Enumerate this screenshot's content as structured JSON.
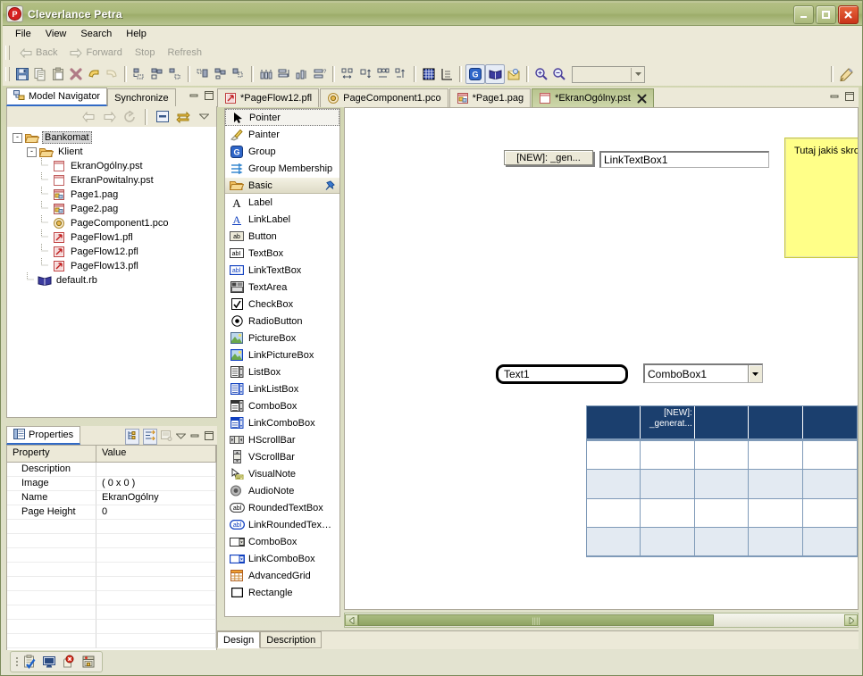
{
  "window": {
    "title": "Cleverlance Petra",
    "app_icon": "petra-logo-icon",
    "minimize": "_",
    "maximize": "□",
    "close": "✕"
  },
  "menubar": {
    "items": [
      "File",
      "View",
      "Search",
      "Help"
    ]
  },
  "nav_toolbar": {
    "back": "Back",
    "forward": "Forward",
    "stop": "Stop",
    "refresh": "Refresh"
  },
  "main_toolbar": {
    "zoom_value": "",
    "icons": [
      "save-icon",
      "copy-icon",
      "paste-icon",
      "delete-icon",
      "undo-icon",
      "redo-icon",
      "align-left-icon",
      "align-center-icon",
      "align-right-icon",
      "align-top-icon",
      "align-middle-icon",
      "align-bottom-icon",
      "distribute-h-icon",
      "distribute-v-icon",
      "space-h-icon",
      "space-v-icon",
      "size-width-icon",
      "size-height-icon",
      "size-both-icon",
      "size-grid-icon",
      "grid-icon",
      "ruler-icon",
      "group-icon",
      "book-icon",
      "mail-icon",
      "zoom-in-icon",
      "zoom-out-icon",
      "pencil-icon"
    ]
  },
  "navigator": {
    "tabs": [
      {
        "label": "Model Navigator",
        "icon": "model-navigator-icon",
        "active": true
      },
      {
        "label": "Synchronize",
        "icon": "",
        "active": false
      }
    ],
    "toolbar_icons": [
      "back-arrow-icon",
      "forward-arrow-icon",
      "refresh-icon",
      "collapse-all-icon",
      "link-editor-icon",
      "view-menu-icon"
    ],
    "panel_controls": [
      "minimize-icon",
      "maximize-icon"
    ],
    "tree": [
      {
        "label": "Bankomat",
        "icon": "folder-open-icon",
        "depth": 0,
        "expander": "-",
        "selected": true
      },
      {
        "label": "Klient",
        "icon": "folder-open-icon",
        "depth": 1,
        "expander": "-",
        "selected": false
      },
      {
        "label": "EkranOgólny.pst",
        "icon": "screen-file-icon",
        "depth": 2,
        "expander": "",
        "selected": false
      },
      {
        "label": "EkranPowitalny.pst",
        "icon": "screen-file-icon",
        "depth": 2,
        "expander": "",
        "selected": false
      },
      {
        "label": "Page1.pag",
        "icon": "page-file-icon",
        "depth": 2,
        "expander": "",
        "selected": false
      },
      {
        "label": "Page2.pag",
        "icon": "page-file-icon",
        "depth": 2,
        "expander": "",
        "selected": false
      },
      {
        "label": "PageComponent1.pco",
        "icon": "component-file-icon",
        "depth": 2,
        "expander": "",
        "selected": false
      },
      {
        "label": "PageFlow1.pfl",
        "icon": "flow-file-icon",
        "depth": 2,
        "expander": "",
        "selected": false
      },
      {
        "label": "PageFlow12.pfl",
        "icon": "flow-file-icon",
        "depth": 2,
        "expander": "",
        "selected": false
      },
      {
        "label": "PageFlow13.pfl",
        "icon": "flow-file-icon",
        "depth": 2,
        "expander": "",
        "selected": false
      },
      {
        "label": "default.rb",
        "icon": "book-file-icon",
        "depth": 1,
        "expander": "",
        "selected": false
      }
    ]
  },
  "properties": {
    "tab_label": "Properties",
    "tab_icon": "properties-icon",
    "toolbar_icons": [
      "categorize-icon",
      "sort-icon",
      "restore-default-icon",
      "view-menu-icon",
      "minimize-icon",
      "maximize-icon"
    ],
    "columns": [
      "Property",
      "Value"
    ],
    "rows": [
      {
        "property": "Description",
        "value": ""
      },
      {
        "property": "Image",
        "value": "( 0 x 0 )"
      },
      {
        "property": "Name",
        "value": "EkranOgólny"
      },
      {
        "property": "Page Height",
        "value": "0"
      }
    ]
  },
  "palette": {
    "items": [
      {
        "label": "Pointer",
        "icon": "pointer-icon",
        "kind": "tool",
        "selected": true
      },
      {
        "label": "Painter",
        "icon": "painter-icon",
        "kind": "tool",
        "selected": false
      },
      {
        "label": "Group",
        "icon": "group-g-icon",
        "kind": "tool",
        "selected": false
      },
      {
        "label": "Group Membership",
        "icon": "group-membership-icon",
        "kind": "tool",
        "selected": false
      },
      {
        "label": "Basic",
        "icon": "folder-open-icon",
        "kind": "category",
        "selected": false,
        "pin": "pin-icon"
      },
      {
        "label": "Label",
        "icon": "label-icon",
        "kind": "widget",
        "selected": false
      },
      {
        "label": "LinkLabel",
        "icon": "link-label-icon",
        "kind": "widget",
        "selected": false
      },
      {
        "label": "Button",
        "icon": "button-icon",
        "kind": "widget",
        "selected": false
      },
      {
        "label": "TextBox",
        "icon": "textbox-icon",
        "kind": "widget",
        "selected": false
      },
      {
        "label": "LinkTextBox",
        "icon": "link-textbox-icon",
        "kind": "widget",
        "selected": false
      },
      {
        "label": "TextArea",
        "icon": "textarea-icon",
        "kind": "widget",
        "selected": false
      },
      {
        "label": "CheckBox",
        "icon": "checkbox-icon",
        "kind": "widget",
        "selected": false
      },
      {
        "label": "RadioButton",
        "icon": "radiobutton-icon",
        "kind": "widget",
        "selected": false
      },
      {
        "label": "PictureBox",
        "icon": "picturebox-icon",
        "kind": "widget",
        "selected": false
      },
      {
        "label": "LinkPictureBox",
        "icon": "link-picturebox-icon",
        "kind": "widget",
        "selected": false
      },
      {
        "label": "ListBox",
        "icon": "listbox-icon",
        "kind": "widget",
        "selected": false
      },
      {
        "label": "LinkListBox",
        "icon": "link-listbox-icon",
        "kind": "widget",
        "selected": false
      },
      {
        "label": "ComboBox",
        "icon": "combobox-list-icon",
        "kind": "widget",
        "selected": false
      },
      {
        "label": "LinkComboBox",
        "icon": "link-combobox-list-icon",
        "kind": "widget",
        "selected": false
      },
      {
        "label": "HScrollBar",
        "icon": "hscrollbar-icon",
        "kind": "widget",
        "selected": false
      },
      {
        "label": "VScrollBar",
        "icon": "vscrollbar-icon",
        "kind": "widget",
        "selected": false
      },
      {
        "label": "VisualNote",
        "icon": "visualnote-icon",
        "kind": "widget",
        "selected": false
      },
      {
        "label": "AudioNote",
        "icon": "audionote-icon",
        "kind": "widget",
        "selected": false
      },
      {
        "label": "RoundedTextBox",
        "icon": "rounded-textbox-icon",
        "kind": "widget",
        "selected": false
      },
      {
        "label": "LinkRoundedTex…",
        "icon": "link-rounded-textbox-icon",
        "kind": "widget",
        "selected": false
      },
      {
        "label": "ComboBox",
        "icon": "combobox-icon",
        "kind": "widget",
        "selected": false
      },
      {
        "label": "LinkComboBox",
        "icon": "link-combobox-icon",
        "kind": "widget",
        "selected": false
      },
      {
        "label": "AdvancedGrid",
        "icon": "advancedgrid-icon",
        "kind": "widget",
        "selected": false
      },
      {
        "label": "Rectangle",
        "icon": "rectangle-icon",
        "kind": "widget",
        "selected": false
      }
    ]
  },
  "editor": {
    "tabs": [
      {
        "label": "*PageFlow12.pfl",
        "icon": "flow-file-icon",
        "active": false,
        "closable": false
      },
      {
        "label": "PageComponent1.pco",
        "icon": "component-file-icon",
        "active": false,
        "closable": false
      },
      {
        "label": "*Page1.pag",
        "icon": "page-file-icon",
        "active": false,
        "closable": false
      },
      {
        "label": "*EkranOgólny.pst",
        "icon": "screen-file-icon",
        "active": true,
        "closable": true,
        "close_icon": "close-icon"
      }
    ],
    "panel_controls": [
      "minimize-icon",
      "maximize-icon"
    ],
    "bottom_tabs": [
      {
        "label": "Design",
        "active": true
      },
      {
        "label": "Description",
        "active": false
      }
    ],
    "hscroll": {
      "left_arrow": "◀",
      "right_arrow": "▶",
      "thumb_grip": "||||"
    }
  },
  "canvas": {
    "widgets": [
      {
        "name": "button-new-gen",
        "type": "button",
        "text": "[NEW]: _gen..."
      },
      {
        "name": "link-textbox-1",
        "type": "textbox",
        "text": "LinkTextBox1"
      },
      {
        "name": "visual-note",
        "type": "note",
        "text": "Tutaj jakiś skromny tekst"
      },
      {
        "name": "rounded-textbox",
        "type": "rounded-input",
        "text": "Text1"
      },
      {
        "name": "combobox-1",
        "type": "combobox",
        "text": "ComboBox1",
        "arrow": "▾"
      }
    ],
    "grid": {
      "name": "advanced-grid",
      "header_cells": [
        "",
        "[NEW]: _generat...",
        "",
        "",
        ""
      ],
      "row_count": 4,
      "column_count": 5,
      "scroll_up": "▲",
      "scroll_down": "▼"
    }
  },
  "statusbar": {
    "icons": [
      "tasks-icon",
      "console-icon",
      "problems-icon",
      "properties-view-icon"
    ]
  },
  "colors": {
    "title_gradient_top": "#b3bf84",
    "title_gradient_bottom": "#9dad6a",
    "chrome": "#ece9d8",
    "active_tab": "#b8c48e",
    "grid_header": "#1b3f6e",
    "note_yellow": "#ffff88",
    "close_button": "#c9341a"
  }
}
